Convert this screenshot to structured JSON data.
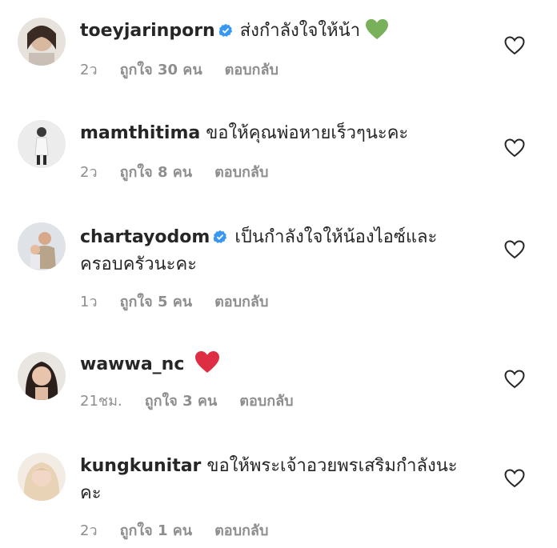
{
  "comments": [
    {
      "username": "toeyjarinporn",
      "verified": true,
      "text": "ส่งกำลังใจให้น้า",
      "emoji": "green-heart",
      "time": "2ว",
      "likes": "ถูกใจ 30 คน",
      "reply": "ตอบกลับ"
    },
    {
      "username": "mamthitima",
      "verified": false,
      "text": "ขอให้คุณพ่อหายเร็วๆนะคะ",
      "time": "2ว",
      "likes": "ถูกใจ 8 คน",
      "reply": "ตอบกลับ"
    },
    {
      "username": "chartayodom",
      "verified": true,
      "text": "เป็นกำลังใจให้น้องไอซ์และครอบครัวนะคะ",
      "time": "1ว",
      "likes": "ถูกใจ 5 คน",
      "reply": "ตอบกลับ"
    },
    {
      "username": "wawwa_nc",
      "verified": false,
      "text": "",
      "emoji": "red-heart",
      "time": "21ชม.",
      "likes": "ถูกใจ 3 คน",
      "reply": "ตอบกลับ"
    },
    {
      "username": "kungkunitar",
      "verified": false,
      "text": "ขอให้พระเจ้าอวยพรเสริมกำลังนะคะ",
      "time": "2ว",
      "likes": "ถูกใจ 1 คน",
      "reply": "ตอบกลับ"
    }
  ],
  "colors": {
    "text": "#262626",
    "meta": "#8e8e8e",
    "verified": "#3897f0",
    "green_heart": "#78b159",
    "red_heart": "#dd2e44"
  }
}
